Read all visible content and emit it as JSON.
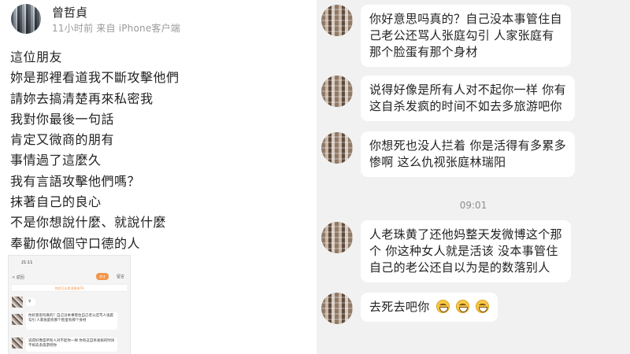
{
  "post": {
    "user_name": "曾哲貞",
    "meta": "11小时前 来自 iPhone客户端",
    "lines": [
      "這位朋友",
      "妳是那裡看道我不斷攻擊他們",
      "請妳去搞清楚再來私密我",
      "我對你最後一句話",
      "肯定又微商的朋有",
      "事情過了這麼久",
      "我有言語攻擊他們嗎？",
      "抹著自己的良心",
      "不是你想說什麼、就說什麼",
      "奉勸你做個守口德的人"
    ]
  },
  "thumbnail": {
    "status_time": "21:11",
    "back_label": "< 返回",
    "button_label": "关注",
    "more_label": "留言",
    "bar_text": "你也可以发消息给TA",
    "messages": [
      "♀",
      "你好意思吗真的？自己没本事管住自己老公还骂人张庭勾引 人家张庭有那个脸蛋有那个身材",
      "说得好像是所有人对不起你一样 你有这自杀发疯的时间不如去多旅游吧你"
    ]
  },
  "chat": {
    "messages": [
      {
        "lines": [
          "你好意思吗真的？自己没本事管住自",
          "己老公还骂人张庭勾引 人家张庭有",
          "那个脸蛋有那个身材"
        ]
      },
      {
        "lines": [
          "说得好像是所有人对不起你一样 你有",
          "这自杀发疯的时间不如去多旅游吧你"
        ]
      },
      {
        "lines": [
          "你想死也没人拦着 你是活得有多累多",
          "惨啊 这么仇视张庭林瑞阳"
        ]
      },
      {
        "lines": [
          "人老珠黄了还他妈整天发微博这个那",
          "个 你这种女人就是活该 没本事管住",
          "自己的老公还自以为是的数落别人"
        ]
      },
      {
        "lines": [
          "去死去吧你"
        ]
      }
    ],
    "timestamp": "09:01",
    "emoji_name": "grin-emoji"
  }
}
